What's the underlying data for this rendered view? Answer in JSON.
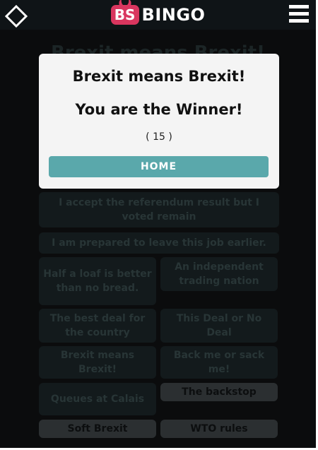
{
  "header": {
    "logo_badge": "BS",
    "logo_text": "BINGO"
  },
  "board": {
    "title": "Brexit means Brexit!",
    "tiles": [
      "I accept the referendum result but I voted remain",
      "I am prepared to leave this job earlier.",
      "Half a loaf is better than no bread.",
      "An independent trading nation",
      "The best deal for the country",
      "This Deal or No Deal",
      "Brexit means Brexit!",
      "Back me or sack me!",
      "Queues at Calais",
      "The backstop",
      "Soft Brexit",
      "WTO rules"
    ]
  },
  "modal": {
    "title": "Brexit means Brexit!",
    "winner_text": "You are the Winner!",
    "score_text": "( 15 )",
    "home_label": "HOME"
  },
  "colors": {
    "background": "#0b0c0d",
    "modal": "#f4f4f4",
    "home_button": "#5aa8ab",
    "logo_badge": "#d9365f"
  },
  "icons": {
    "left": "diamond-icon",
    "right": "hamburger-menu-icon"
  }
}
